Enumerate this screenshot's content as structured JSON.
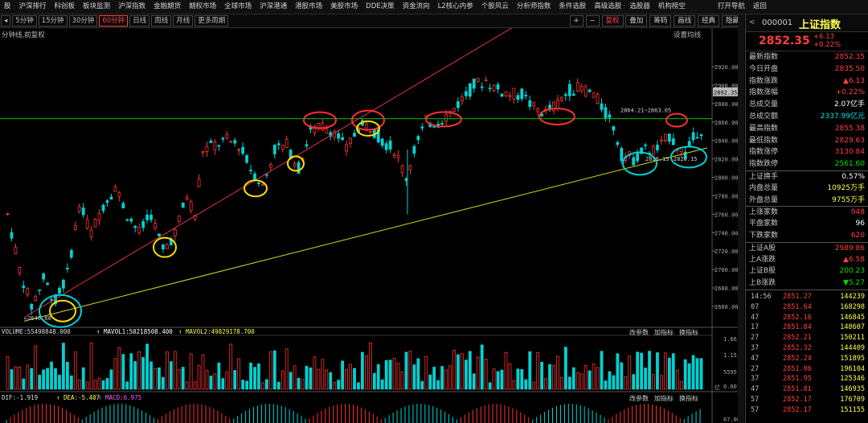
{
  "menu": [
    "股",
    "沪深排行",
    "科创板",
    "板块监测",
    "沪深指数",
    "金融期货",
    "期权市场",
    "全球市场",
    "沪深港通",
    "港股市场",
    "美股市场",
    "DDE决策",
    "资金流向",
    "L2核心内参",
    "个股风云",
    "分析师指数",
    "条件选股",
    "高级选股",
    "选股器",
    "机构榜空",
    "打开导航",
    "返回"
  ],
  "periods": [
    "5分钟",
    "15分钟",
    "30分钟",
    "60分钟",
    "日线",
    "周线",
    "月线",
    "更多周期"
  ],
  "active_period": "60分钟",
  "tools": [
    "复权",
    "叠加",
    "筹码",
    "画线",
    "经典",
    "隐藏"
  ],
  "chart": {
    "title": "分钟线,前复权",
    "settings": "设置均线",
    "price_ticks": [
      "2920.00",
      "2900.00",
      "2880.00",
      "2860.00",
      "2840.00",
      "2820.00",
      "2800.00",
      "2780.00",
      "2760.00",
      "2740.00",
      "2720.00",
      "2700.00",
      "2680.00",
      "2660.00"
    ],
    "price_tag": "2892.35",
    "hline_label": "2864.21~2863.05",
    "low_label": "2646.80",
    "low2_label": "2820.15",
    "low3_label": "2818.15",
    "volume_label": "VOLUME:55498848.000",
    "mavol1": "MAVOL1:50218508.400",
    "mavol2": "MAVOL2:49829178.700",
    "vol_ticks": [
      "1.66",
      "1.15",
      "5595.00",
      "0.00"
    ],
    "vol_unit": "亿",
    "macd_label": "DIF:-1.919",
    "dea_label": "DEA:-5.407",
    "macd_val": "MACD:6.975",
    "macd_tick": "67.00",
    "sub_buttons": [
      "改参数",
      "加指标",
      "换指标"
    ],
    "macd_buttons": [
      "改参数",
      "加指标",
      "换指标"
    ]
  },
  "quote": {
    "prev_label": "<",
    "code": "000001",
    "name": "上证指数",
    "last": "2852.35",
    "change": "+6.13",
    "change_pct": "+0.22%",
    "rows": [
      {
        "k": "最新指数",
        "v": "2852.35",
        "c": "red"
      },
      {
        "k": "今日开盘",
        "v": "2835.50",
        "c": "red"
      },
      {
        "k": "指数涨跌",
        "v": "▲6.13",
        "c": "red"
      },
      {
        "k": "指数涨幅",
        "v": "+0.22%",
        "c": "red"
      },
      {
        "k": "总成交量",
        "v": "2.07亿手",
        "c": "white"
      },
      {
        "k": "总成交额",
        "v": "2337.99亿元",
        "c": "cyan"
      },
      {
        "k": "最高指数",
        "v": "2855.38",
        "c": "red"
      },
      {
        "k": "最低指数",
        "v": "2829.63",
        "c": "red"
      },
      {
        "k": "指数涨停",
        "v": "3130.84",
        "c": "red"
      },
      {
        "k": "指数跌停",
        "v": "2561.60",
        "c": "green"
      }
    ],
    "rows2": [
      {
        "k": "上证换手",
        "v": "0.57%",
        "c": "white"
      },
      {
        "k": "内盘总量",
        "v": "10925万手",
        "c": "yellow"
      },
      {
        "k": "外盘总量",
        "v": "9755万手",
        "c": "yellow"
      }
    ],
    "rows3": [
      {
        "k": "上涨家数",
        "v": "948",
        "c": "red"
      },
      {
        "k": "平盘家数",
        "v": "96",
        "c": "white"
      },
      {
        "k": "下跌家数",
        "v": "620",
        "c": "red"
      }
    ],
    "rows4": [
      {
        "k": "上证A股",
        "v": "2989.86",
        "c": "red"
      },
      {
        "k": "上A涨跌",
        "v": "▲6.58",
        "c": "red"
      },
      {
        "k": "上证B股",
        "v": "200.23",
        "c": "green"
      },
      {
        "k": "上B涨跌",
        "v": "▼5.27",
        "c": "green"
      }
    ],
    "ticks": [
      {
        "t": "14:56",
        "p": "2851.27",
        "q": "144239"
      },
      {
        "t": "07",
        "p": "2851.64",
        "q": "168298"
      },
      {
        "t": "47",
        "p": "2852.16",
        "q": "146845"
      },
      {
        "t": "17",
        "p": "2851.84",
        "q": "148607"
      },
      {
        "t": "27",
        "p": "2852.21",
        "q": "150211"
      },
      {
        "t": "37",
        "p": "2852.32",
        "q": "144409"
      },
      {
        "t": "47",
        "p": "2852.24",
        "q": "151895"
      },
      {
        "t": "27",
        "p": "2851.06",
        "q": "196104"
      },
      {
        "t": "37",
        "p": "2851.95",
        "q": "125346"
      },
      {
        "t": "47",
        "p": "2851.81",
        "q": "146935"
      },
      {
        "t": "57",
        "p": "2852.17",
        "q": "176709"
      },
      {
        "t": "57",
        "p": "2852.17",
        "q": "151155"
      }
    ]
  },
  "colors": {
    "up": "#ff3232",
    "down": "#00d2d2",
    "trend_red": "#e0304a",
    "trend_yellow": "#d8d820",
    "hline": "#00c000",
    "circle_red": "#ff3030",
    "circle_yellow": "#ffe000",
    "circle_cyan": "#00d0d0"
  }
}
